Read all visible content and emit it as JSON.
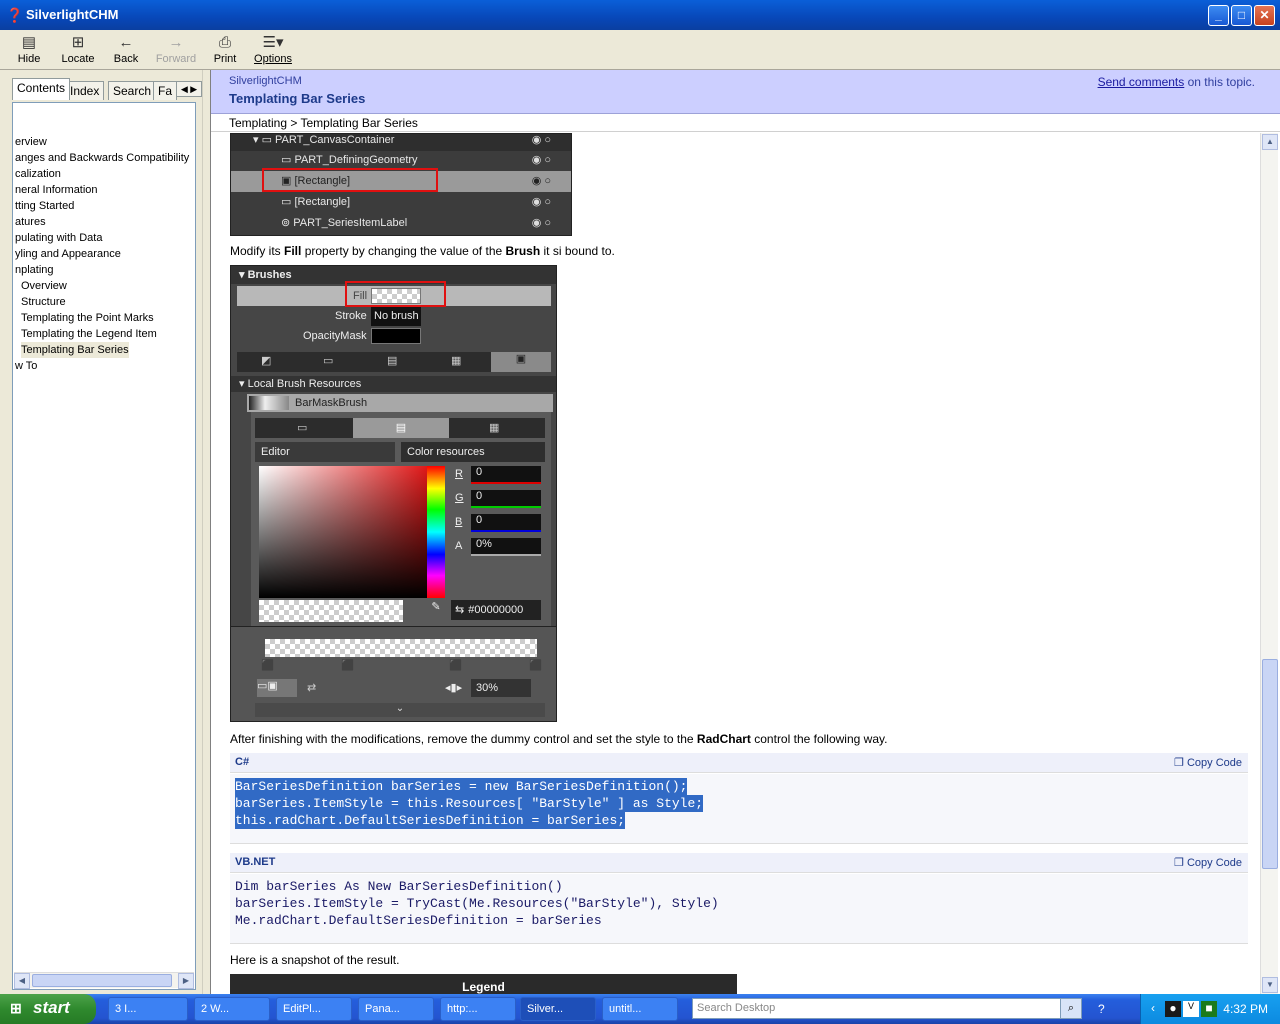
{
  "window": {
    "title": "SilverlightCHM",
    "minimize": "_",
    "maximize": "□",
    "close": "✕"
  },
  "toolbar": {
    "hide": "Hide",
    "locate": "Locate",
    "back": "Back",
    "forward": "Forward",
    "print": "Print",
    "options": "Options"
  },
  "nav": {
    "tabs": [
      "Contents",
      "Index",
      "Search",
      "Fa"
    ],
    "tree": [
      "erview",
      "anges and Backwards Compatibility",
      "calization",
      "neral Information",
      "tting Started",
      "atures",
      "pulating with Data",
      "yling and Appearance",
      "nplating",
      "Overview",
      "Structure",
      "Templating the Point Marks",
      "Templating the Legend Item",
      "Templating Bar Series",
      "w To"
    ]
  },
  "header": {
    "product": "SilverlightCHM",
    "title": "Templating Bar Series",
    "feedback_link": "Send comments",
    "feedback_rest": " on this topic."
  },
  "breadcrumb": "Templating > Templating Bar Series",
  "layers": {
    "items": [
      "PART_CanvasContainer",
      "PART_DefiningGeometry",
      "[Rectangle]",
      "[Rectangle]",
      "PART_SeriesItemLabel"
    ]
  },
  "text1": {
    "a": "Modify its ",
    "b": "Fill",
    "c": " property by changing the value of the ",
    "d": "Brush",
    "e": " it si bound to."
  },
  "brushes": {
    "header": "Brushes",
    "fill": "Fill",
    "stroke": "Stroke",
    "stroke_value": "No brush",
    "opacitymask": "OpacityMask",
    "local_resources": "Local Brush Resources",
    "resource_name": "BarMaskBrush",
    "editor": "Editor",
    "color_resources": "Color resources",
    "r_label": "R",
    "g_label": "G",
    "b_label": "B",
    "a_label": "A",
    "r": "0",
    "g": "0",
    "b": "0",
    "a": "0%",
    "hex": "#00000000",
    "stop_offset": "30%"
  },
  "text2": {
    "a": "After finishing with the modifications, remove the dummy control and set the style to the ",
    "b": "RadChart",
    "c": " control the following way."
  },
  "csharp": {
    "lang": "C#",
    "copy": "Copy Code",
    "lines": [
      "BarSeriesDefinition barSeries = new BarSeriesDefinition();",
      "barSeries.ItemStyle = this.Resources[ \"BarStyle\" ] as Style;",
      "this.radChart.DefaultSeriesDefinition = barSeries;"
    ]
  },
  "vbnet": {
    "lang": "VB.NET",
    "copy": "Copy Code",
    "lines": [
      "Dim barSeries As New BarSeriesDefinition()",
      "barSeries.ItemStyle = TryCast(Me.Resources(\"BarStyle\"), Style)",
      "Me.radChart.DefaultSeriesDefinition = barSeries"
    ]
  },
  "text3": "Here is a snapshot of the result.",
  "result_preview_label": "Legend",
  "taskbar": {
    "start": "start",
    "tasks": [
      "3 I...",
      "2 W...",
      "EditPl...",
      "Pana...",
      "http:...",
      "Silver...",
      "untitl..."
    ],
    "search_placeholder": "Search Desktop",
    "time": "4:32 PM"
  }
}
